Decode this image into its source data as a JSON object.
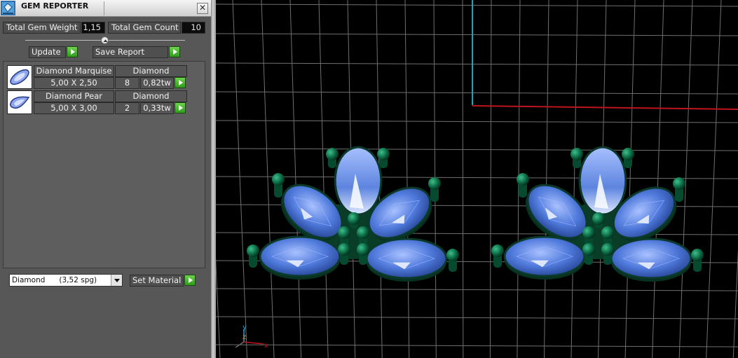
{
  "title": "GEM REPORTER",
  "close_glyph": "✕",
  "summary": {
    "total_weight_label": "Total Gem Weight",
    "total_weight_value": "1,15",
    "total_count_label": "Total Gem Count",
    "total_count_value": "10"
  },
  "actions": {
    "update_label": "Update",
    "save_report_label": "Save Report"
  },
  "gems": [
    {
      "name": "Diamond Marquise",
      "material": "Diamond",
      "size": "5,00 X 2,50",
      "count": "8",
      "weight": "0,82tw",
      "shape": "marquise"
    },
    {
      "name": "Diamond Pear",
      "material": "Diamond",
      "size": "5,00 X 3,00",
      "count": "2",
      "weight": "0,33tw",
      "shape": "pear"
    }
  ],
  "material_select": {
    "selected": "Diamond      (3,52 spg)"
  },
  "set_material_label": "Set Material",
  "viewport": {
    "axis_y_label": "y",
    "axis_z_label": "z",
    "axis_x_label": "x"
  },
  "colors": {
    "accent_go": "#3aa82a",
    "gem_blue": "#4a74d6",
    "prong_green": "#0a5a3a",
    "grid": "#6f6f6f",
    "axis_x": "#c0141c",
    "axis_y": "#19a7b5"
  }
}
